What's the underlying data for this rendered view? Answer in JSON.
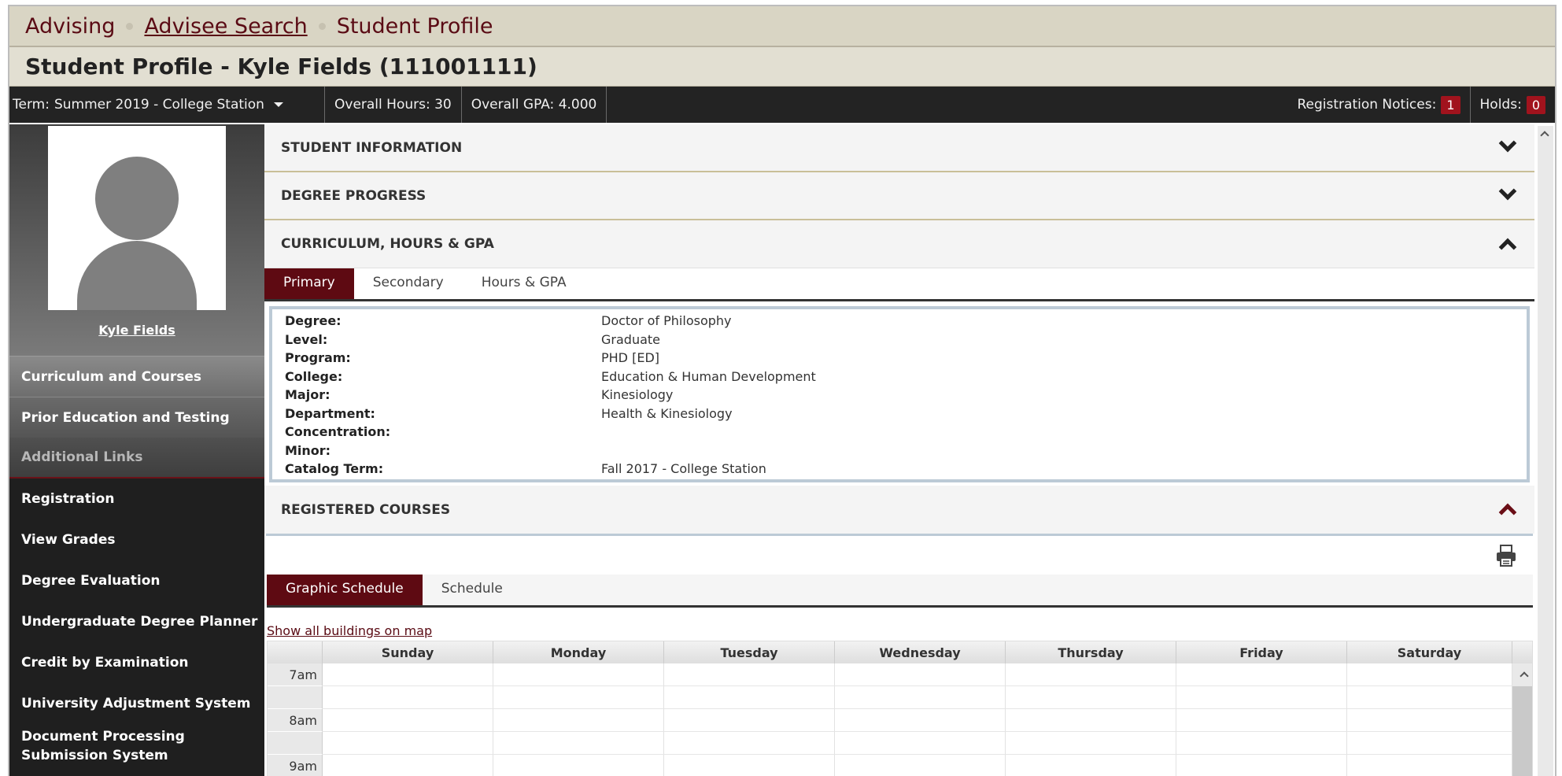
{
  "breadcrumb": {
    "advising": "Advising",
    "advisee_search": "Advisee Search",
    "student_profile": "Student Profile"
  },
  "page": {
    "title": "Student Profile - Kyle Fields (111001111)"
  },
  "status_bar": {
    "term_prefix": "Term:",
    "term_value": "Summer 2019 - College Station",
    "overall_hours": "Overall Hours: 30",
    "overall_gpa": "Overall GPA: 4.000",
    "registration_notices_label": "Registration Notices:",
    "registration_notices_count": "1",
    "holds_label": "Holds:",
    "holds_count": "0"
  },
  "sidebar": {
    "student_name": "Kyle Fields",
    "items": [
      {
        "label": "Curriculum and Courses"
      },
      {
        "label": "Prior Education and Testing"
      },
      {
        "label": "Additional Links"
      },
      {
        "label": "Registration"
      },
      {
        "label": "View Grades"
      },
      {
        "label": "Degree Evaluation"
      },
      {
        "label": "Undergraduate Degree Planner"
      },
      {
        "label": "Credit by Examination"
      },
      {
        "label": "University Adjustment System"
      },
      {
        "label": "Document Processing Submission System"
      }
    ]
  },
  "sections": {
    "student_information": "STUDENT INFORMATION",
    "degree_progress": "DEGREE PROGRESS",
    "curriculum": "CURRICULUM, HOURS & GPA",
    "registered_courses": "REGISTERED COURSES"
  },
  "curriculum_tabs": [
    "Primary",
    "Secondary",
    "Hours & GPA"
  ],
  "curriculum_info": [
    {
      "label": "Degree:",
      "value": "Doctor of Philosophy"
    },
    {
      "label": "Level:",
      "value": "Graduate"
    },
    {
      "label": "Program:",
      "value": "PHD [ED]"
    },
    {
      "label": "College:",
      "value": "Education & Human Development"
    },
    {
      "label": "Major:",
      "value": "Kinesiology"
    },
    {
      "label": "Department:",
      "value": "Health & Kinesiology"
    },
    {
      "label": "Concentration:",
      "value": ""
    },
    {
      "label": "Minor:",
      "value": ""
    },
    {
      "label": "Catalog Term:",
      "value": "Fall 2017 - College Station"
    }
  ],
  "schedule_tabs": [
    "Graphic Schedule",
    "Schedule"
  ],
  "schedule": {
    "map_link": "Show all buildings on map",
    "days": [
      "Sunday",
      "Monday",
      "Tuesday",
      "Wednesday",
      "Thursday",
      "Friday",
      "Saturday"
    ],
    "times": [
      "7am",
      "",
      "8am",
      "",
      "9am"
    ]
  },
  "icons": {
    "print": "print-icon",
    "chevron_down": "chevron-down-icon",
    "chevron_up": "chevron-up-icon"
  },
  "colors": {
    "maroon": "#5e0a12",
    "badge_red": "#a1131d",
    "breadcrumb_bg": "#d9d5c4",
    "status_bg": "#232323"
  }
}
